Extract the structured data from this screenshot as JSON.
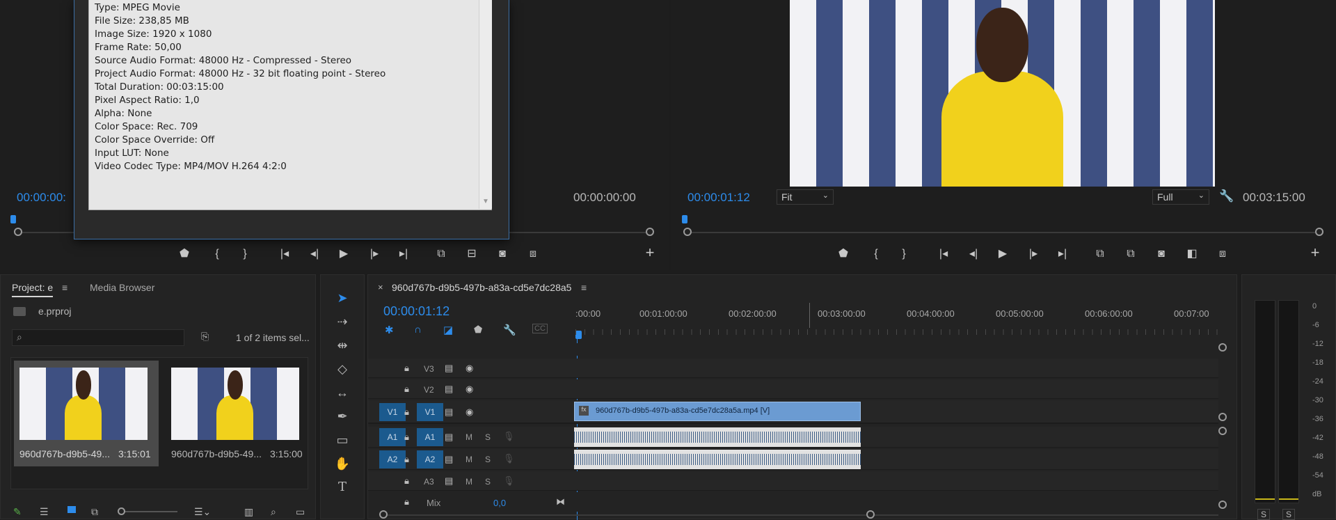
{
  "source_monitor": {
    "timecode_left": "00:00:00:",
    "timecode_right": "00:00:00:00",
    "properties": [
      "Type: MPEG Movie",
      "File Size: 238,85 MB",
      "Image Size: 1920 x 1080",
      "Frame Rate: 50,00",
      "Source Audio Format: 48000 Hz - Compressed - Stereo",
      "Project Audio Format: 48000 Hz - 32 bit floating point - Stereo",
      "Total Duration: 00:03:15:00",
      "Pixel Aspect Ratio: 1,0",
      "Alpha: None",
      "Color Space: Rec. 709",
      "Color Space Override: Off",
      "Input LUT: None",
      "Video Codec Type: MP4/MOV H.264 4:2:0"
    ]
  },
  "program_monitor": {
    "timecode_current": "00:00:01:12",
    "fit_select": "Fit",
    "quality_select": "Full",
    "timecode_duration": "00:03:15:00",
    "wrench_icon": "wrench-icon"
  },
  "project_panel": {
    "tab_project": "Project: e",
    "tab_media_browser": "Media Browser",
    "project_file": "e.prproj",
    "search_placeholder": "",
    "items_count": "1 of 2 items sel...",
    "items": [
      {
        "name": "960d767b-d9b5-49...",
        "duration": "3:15:01",
        "selected": true
      },
      {
        "name": "960d767b-d9b5-49...",
        "duration": "3:15:00",
        "selected": false
      }
    ]
  },
  "timeline": {
    "sequence_tab": "960d767b-d9b5-497b-a83a-cd5e7dc28a5",
    "timecode": "00:00:01:12",
    "ruler_labels": [
      ":00:00",
      "00:01:00:00",
      "00:02:00:00",
      "00:03:00:00",
      "00:04:00:00",
      "00:05:00:00",
      "00:06:00:00",
      "00:07:00"
    ],
    "tracks": {
      "video": [
        {
          "src": "",
          "name": "V3"
        },
        {
          "src": "",
          "name": "V2"
        },
        {
          "src": "V1",
          "name": "V1"
        }
      ],
      "audio": [
        {
          "src": "A1",
          "name": "A1",
          "m": "M",
          "s": "S"
        },
        {
          "src": "A2",
          "name": "A2",
          "m": "M",
          "s": "S"
        },
        {
          "src": "",
          "name": "A3",
          "m": "M",
          "s": "S"
        }
      ],
      "mix_label": "Mix",
      "mix_value": "0,0"
    },
    "video_clip_label": "960d767b-d9b5-497b-a83a-cd5e7dc28a5a.mp4 [V]"
  },
  "audio_meter": {
    "labels": [
      "0",
      "-6",
      "-12",
      "-18",
      "-24",
      "-30",
      "-36",
      "-42",
      "-48",
      "-54",
      "dB"
    ],
    "solo_left": "S",
    "solo_right": "S"
  },
  "colors": {
    "accent_blue": "#2d8ceb",
    "track_blue": "#1b5a8e",
    "clip_video": "#6b9bd2",
    "work_area_yellow": "#e8d11a"
  }
}
